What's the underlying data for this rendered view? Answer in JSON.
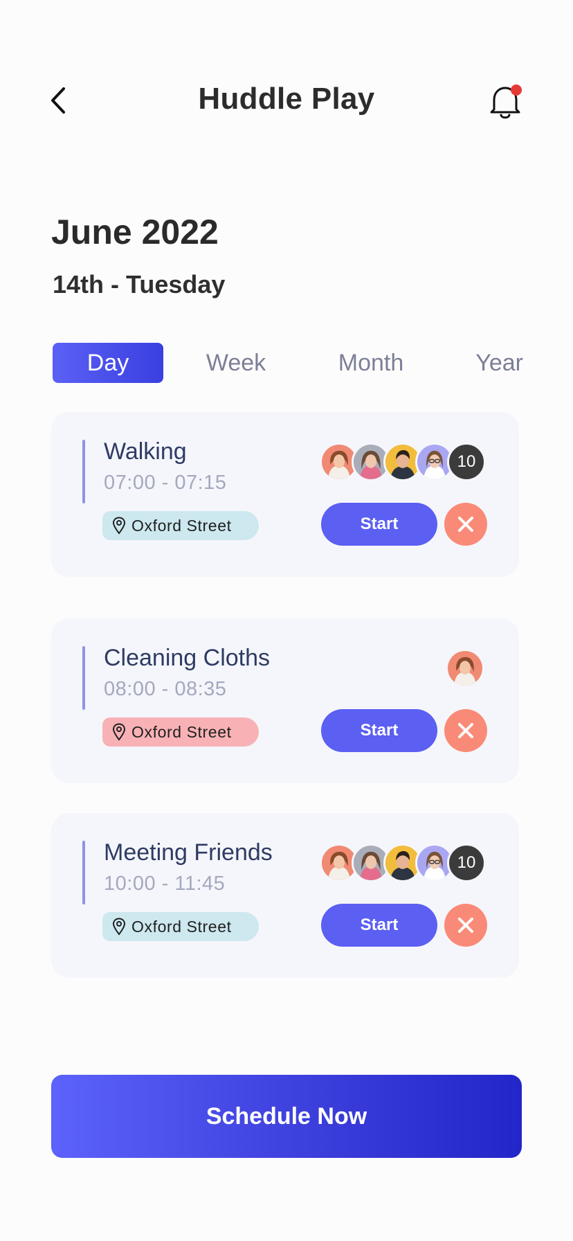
{
  "header": {
    "title": "Huddle Play",
    "back_icon": "chevron-left-icon",
    "bell_icon": "bell-icon",
    "notification_dot_color": "#e53935"
  },
  "calendar": {
    "month": "June 2022",
    "day": "14th - Tuesday"
  },
  "tabs": [
    {
      "label": "Day",
      "active": true
    },
    {
      "label": "Week",
      "active": false
    },
    {
      "label": "Month",
      "active": false
    },
    {
      "label": "Year",
      "active": false
    }
  ],
  "events": [
    {
      "title": "Walking",
      "time": "07:00 - 07:15",
      "location": "Oxford Street",
      "location_color": "#cde8ef",
      "extra_count": "10",
      "start_label": "Start"
    },
    {
      "title": "Cleaning Cloths",
      "time": "08:00 - 08:35",
      "location": "Oxford Street",
      "location_color": "#f8b2b5",
      "start_label": "Start"
    },
    {
      "title": "Meeting Friends",
      "time": "10:00 - 11:45",
      "location": "Oxford Street",
      "location_color": "#cde8ef",
      "extra_count": "10",
      "start_label": "Start"
    }
  ],
  "schedule_button": {
    "label": "Schedule Now"
  },
  "colors": {
    "accent": "#5b5ff2",
    "cancel": "#fa8a78",
    "card_bg": "#f5f6fb"
  }
}
